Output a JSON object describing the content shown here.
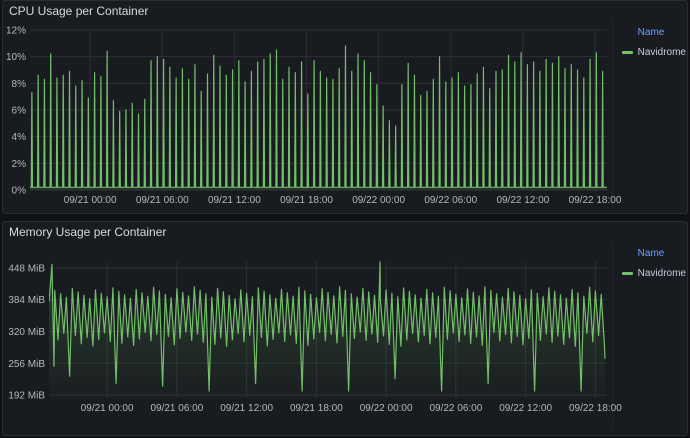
{
  "panels": {
    "cpu": {
      "title": "CPU Usage per Container",
      "legend_header": "Name",
      "legend_item": "Navidrome"
    },
    "memory": {
      "title": "Memory Usage per Container",
      "legend_header": "Name",
      "legend_item": "Navidrome"
    }
  },
  "colors": {
    "series": "#73bf69",
    "background": "#181b1f",
    "grid": "#2c2f35",
    "legend_header": "#6e9fff"
  },
  "chart_data": [
    {
      "type": "line",
      "title": "CPU Usage per Container",
      "x_tick_labels": [
        "09/21 00:00",
        "09/21 06:00",
        "09/21 12:00",
        "09/21 18:00",
        "09/22 00:00",
        "09/22 06:00",
        "09/22 12:00",
        "09/22 18:00"
      ],
      "x_range": [
        "09/20 19:00",
        "09/22 19:00"
      ],
      "y_tick_labels": [
        "0%",
        "2%",
        "4%",
        "6%",
        "8%",
        "10%",
        "12%"
      ],
      "ylim": [
        0,
        12
      ],
      "unit": "%",
      "grid": true,
      "legend_position": "right",
      "series": [
        {
          "name": "Navidrome",
          "description_of_shape": "baseline near 0% with periodic spikes roughly every 30 minutes",
          "baseline": 0.2,
          "spike_peaks": [
            7.3,
            8.6,
            8.3,
            10.2,
            8.4,
            8.6,
            8.9,
            7.8,
            8.2,
            6.9,
            8.8,
            8.5,
            10.4,
            6.7,
            5.9,
            6.0,
            6.5,
            5.7,
            6.8,
            9.7,
            10.0,
            9.8,
            9.2,
            8.4,
            9.1,
            8.3,
            9.4,
            7.4,
            8.7,
            10.1,
            9.3,
            8.6,
            9.0,
            9.7,
            8.1,
            8.9,
            9.6,
            9.8,
            10.2,
            10.5,
            8.3,
            9.2,
            8.8,
            9.6,
            7.2,
            9.7,
            8.9,
            8.4,
            8.3,
            9.1,
            10.8,
            8.9,
            10.2,
            9.7,
            8.8,
            7.9,
            6.3,
            5.2,
            4.8,
            7.9,
            9.5,
            8.6,
            7.1,
            7.4,
            8.3,
            10.0,
            8.1,
            8.4,
            8.8,
            7.8,
            7.9,
            8.7,
            9.2,
            7.6,
            8.9,
            9.0,
            10.1,
            9.6,
            10.3,
            9.4,
            9.6,
            8.9,
            9.8,
            9.5,
            10.0,
            9.1,
            9.4,
            9.0,
            8.4,
            9.8,
            10.3,
            8.9
          ]
        }
      ]
    },
    {
      "type": "line",
      "title": "Memory Usage per Container",
      "x_tick_labels": [
        "09/21 00:00",
        "09/21 06:00",
        "09/21 12:00",
        "09/21 18:00",
        "09/22 00:00",
        "09/22 06:00",
        "09/22 12:00",
        "09/22 18:00"
      ],
      "x_range": [
        "09/20 19:00",
        "09/22 19:00"
      ],
      "y_tick_labels": [
        "192 MiB",
        "256 MiB",
        "320 MiB",
        "384 MiB",
        "448 MiB"
      ],
      "ylim": [
        186,
        460
      ],
      "unit": "MiB",
      "grid": true,
      "legend_position": "right",
      "series": [
        {
          "name": "Navidrome",
          "description_of_shape": "sawtooth oscillating between about 290 and 410 MiB with occasional dips toward 200 MiB",
          "oscillation_high": 410,
          "oscillation_low": 290,
          "start_value": 380,
          "start_peak": 455,
          "dips_to_mib": [
            230,
            215,
            210,
            200,
            215,
            200,
            200,
            225,
            200,
            215,
            200,
            200
          ],
          "peak_near_0922": 460,
          "end_value": 265
        }
      ]
    }
  ]
}
